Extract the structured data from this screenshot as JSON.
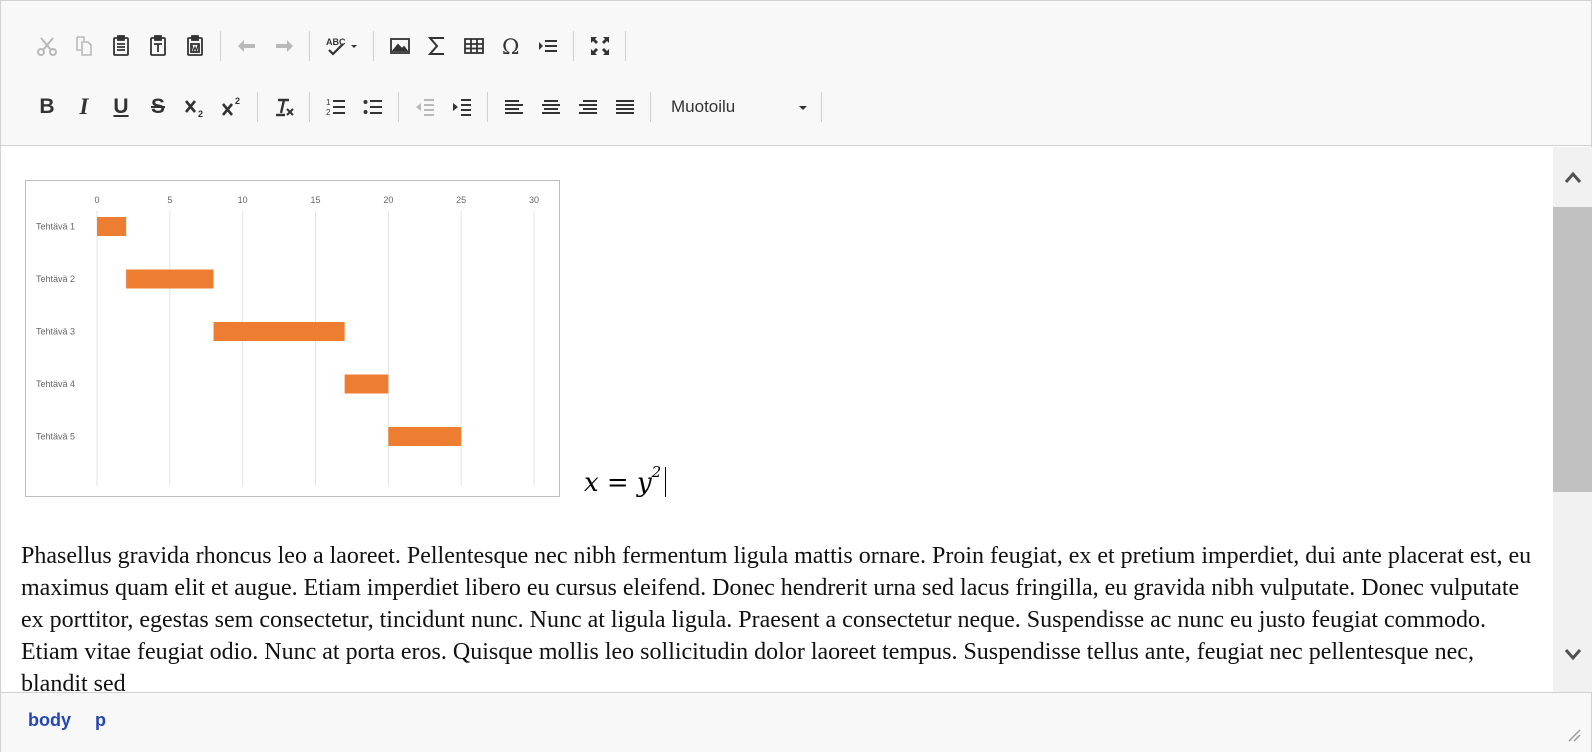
{
  "toolbar": {
    "row1": [
      {
        "name": "cut-icon",
        "disabled": true
      },
      {
        "name": "copy-icon",
        "disabled": true
      },
      {
        "name": "paste-icon"
      },
      {
        "name": "paste-text-icon"
      },
      {
        "name": "paste-from-word-icon"
      },
      {
        "name": "undo-icon",
        "disabled": true
      },
      {
        "name": "redo-icon",
        "disabled": true
      },
      {
        "name": "spellcheck-icon"
      },
      {
        "name": "image-icon"
      },
      {
        "name": "math-sigma-icon"
      },
      {
        "name": "table-icon"
      },
      {
        "name": "special-character-omega-icon"
      },
      {
        "name": "insert-horizontal-line-icon"
      },
      {
        "name": "maximize-icon"
      }
    ],
    "row2": {
      "bold": "B",
      "italic": "I",
      "underline": "U",
      "strike": "S",
      "format_label": "Muotoilu"
    }
  },
  "content": {
    "formula_base": "x = y",
    "formula_exp": "2",
    "paragraph": "Phasellus gravida rhoncus leo a laoreet. Pellentesque nec nibh fermentum ligula mattis ornare. Proin feugiat, ex et pretium imperdiet, dui ante placerat est, eu maximus quam elit et augue. Etiam imperdiet libero eu cursus eleifend. Donec hendrerit urna sed lacus fringilla, eu gravida nibh vulputate. Donec vulputate ex porttitor, egestas sem consectetur, tincidunt nunc. Nunc at ligula ligula. Praesent a consectetur neque. Suspendisse ac nunc eu justo feugiat commodo. Etiam vitae feugiat odio. Nunc at porta eros. Quisque mollis leo sollicitudin dolor laoreet tempus. Suspendisse tellus ante, feugiat nec pellentesque nec, blandit sed"
  },
  "chart_data": {
    "type": "bar",
    "subtype": "gantt",
    "categories": [
      "Tehtävä 1",
      "Tehtävä 2",
      "Tehtävä 3",
      "Tehtävä 4",
      "Tehtävä 5"
    ],
    "start": [
      0,
      2,
      8,
      17,
      20
    ],
    "end": [
      2,
      8,
      17,
      20,
      25
    ],
    "xlim": [
      0,
      30
    ],
    "xticks": [
      0,
      5,
      10,
      15,
      20,
      25,
      30
    ],
    "x_axis_position": "top",
    "grid": true,
    "bar_color": "#ed7d31"
  },
  "pathbar": {
    "item1": "body",
    "item2": "p"
  }
}
